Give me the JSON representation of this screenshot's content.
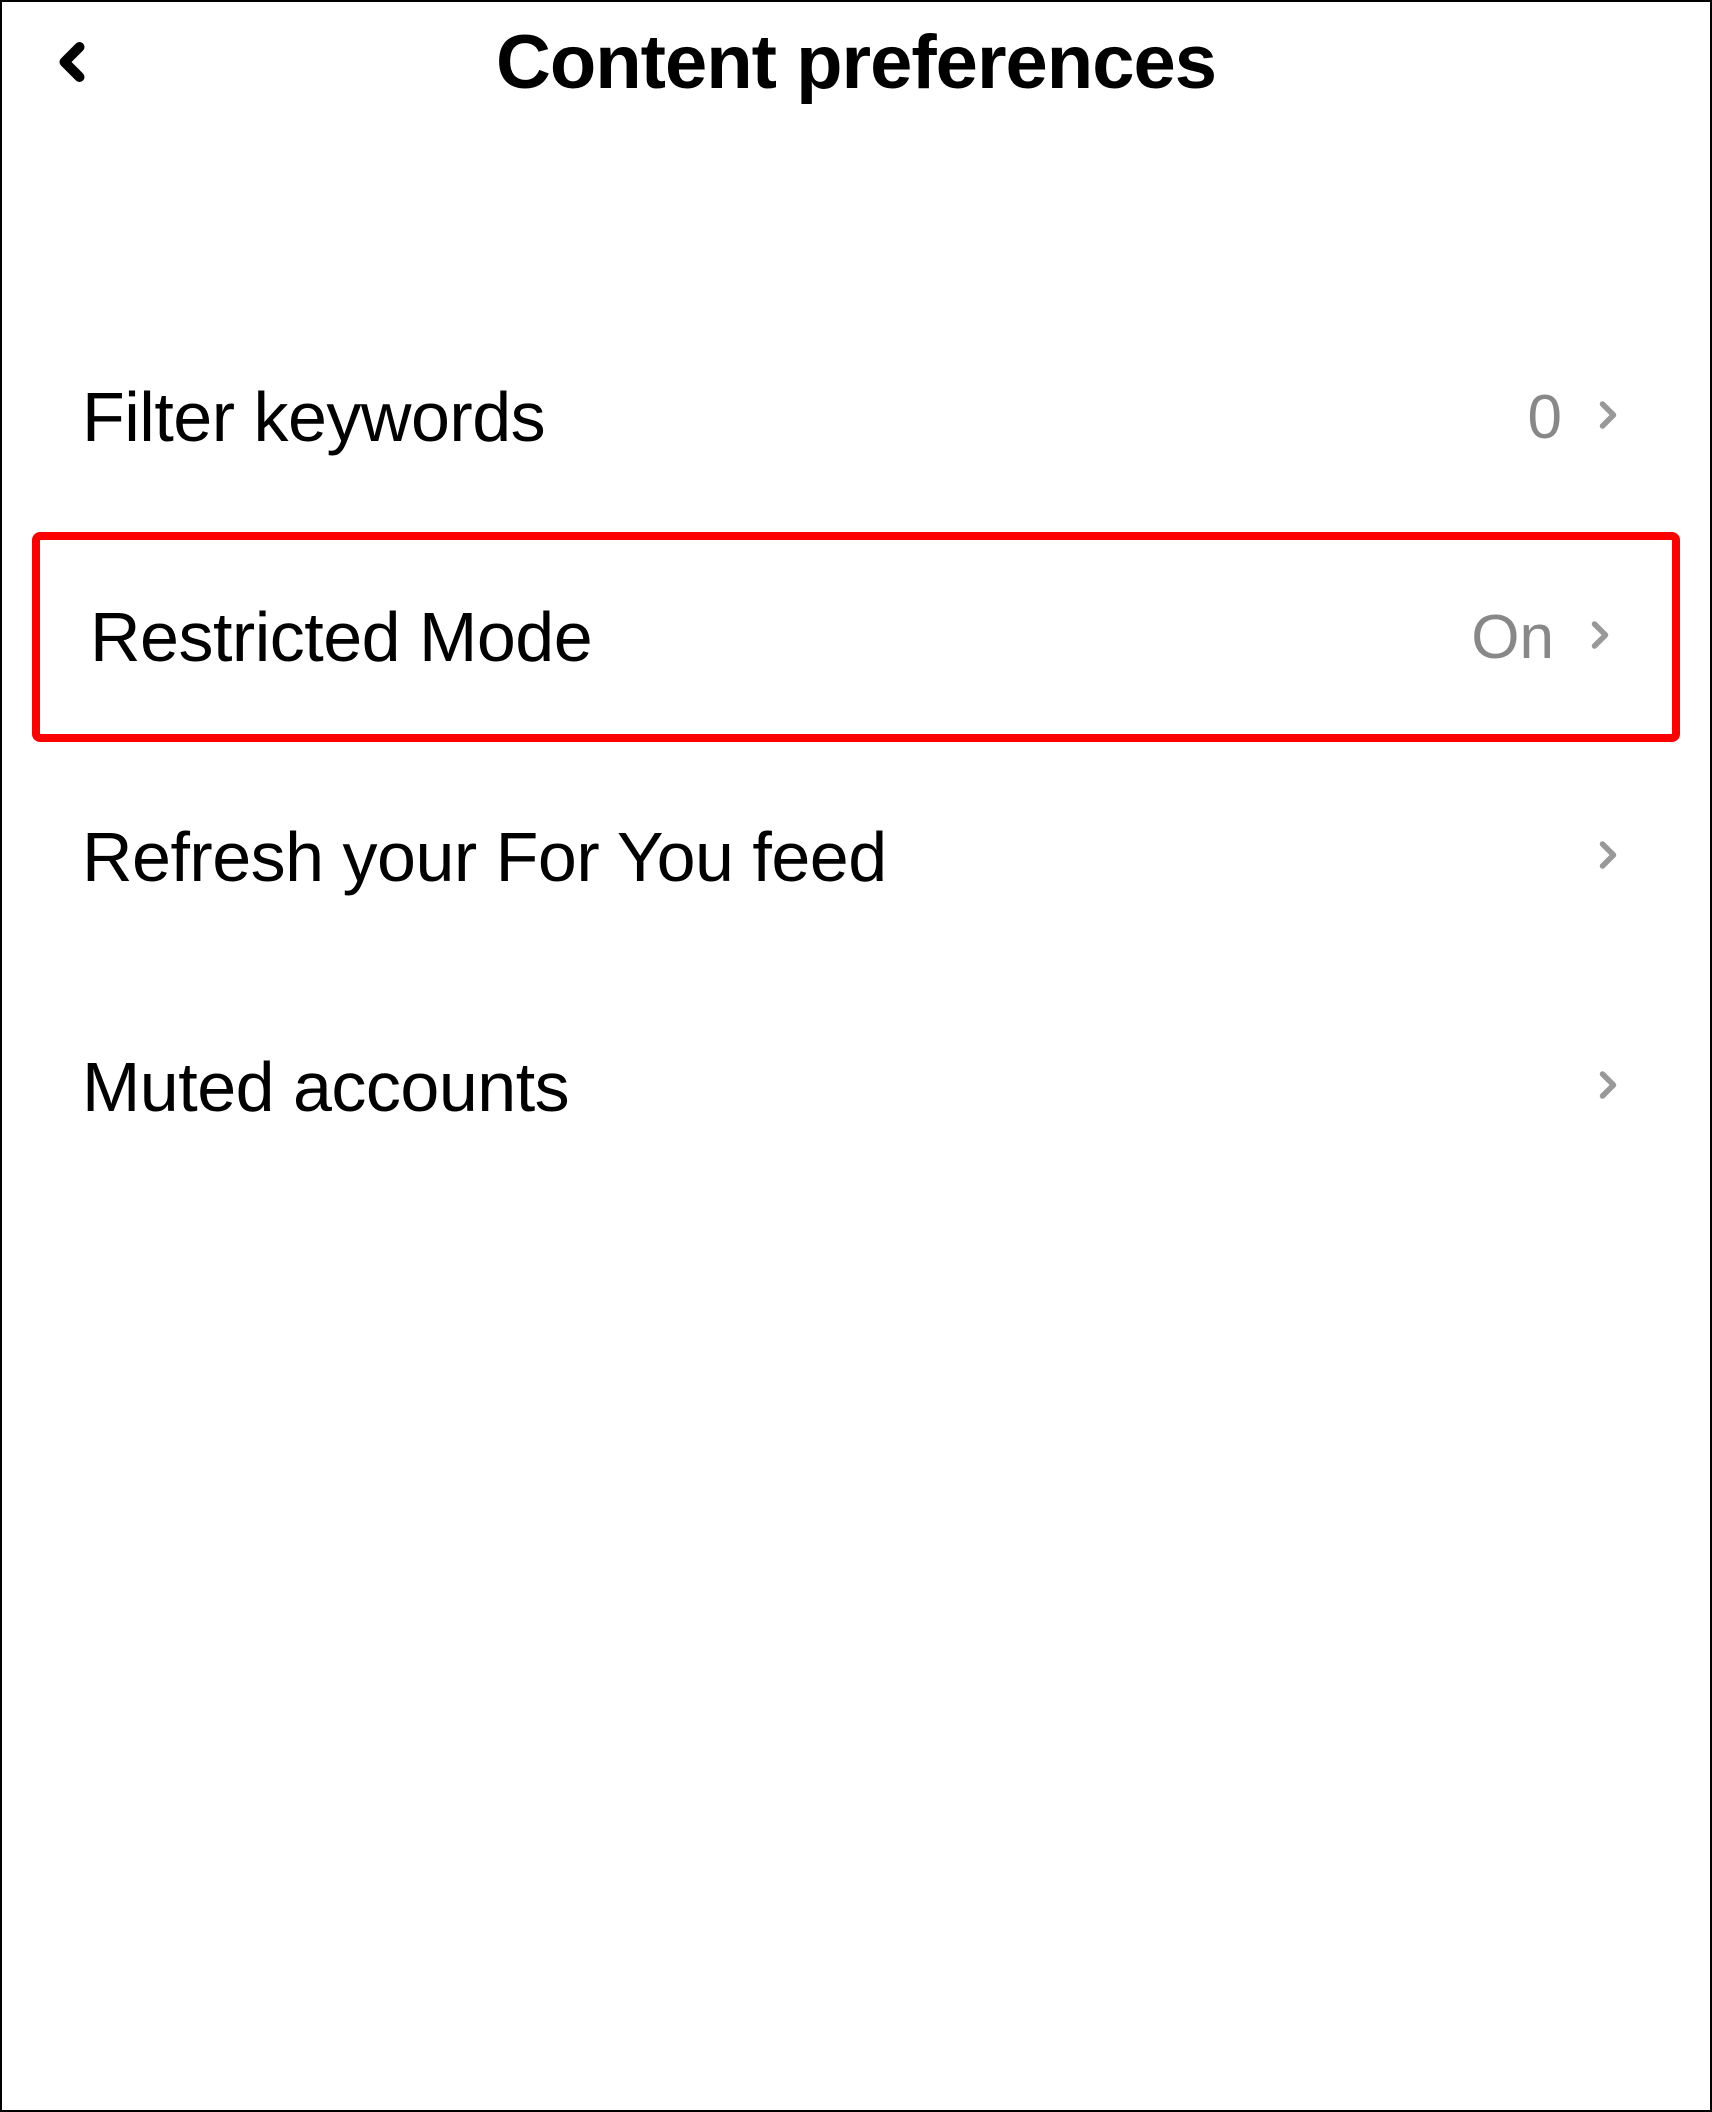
{
  "header": {
    "title": "Content preferences"
  },
  "items": [
    {
      "label": "Filter keywords",
      "value": "0",
      "highlighted": false
    },
    {
      "label": "Restricted Mode",
      "value": "On",
      "highlighted": true
    },
    {
      "label": "Refresh your For You feed",
      "value": "",
      "highlighted": false
    },
    {
      "label": "Muted accounts",
      "value": "",
      "highlighted": false
    }
  ]
}
